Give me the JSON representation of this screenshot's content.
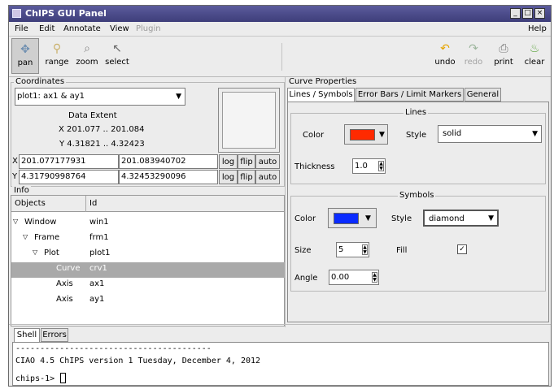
{
  "window": {
    "title": "ChIPS GUI Panel",
    "min": "_",
    "max": "□",
    "close": "×"
  },
  "menu": {
    "file": "File",
    "edit": "Edit",
    "annotate": "Annotate",
    "view": "View",
    "plugin": "Plugin",
    "help": "Help"
  },
  "toolbar": {
    "pan": "pan",
    "range": "range",
    "zoom": "zoom",
    "select": "select",
    "undo": "undo",
    "redo": "redo",
    "print": "print",
    "clear": "clear"
  },
  "coordinates": {
    "title": "Coordinates",
    "plot_select": "plot1: ax1 & ay1",
    "extent_title": "Data Extent",
    "x_extent": "X 201.077 .. 201.084",
    "y_extent": "Y 4.31821 .. 4.32423",
    "x_label": "X",
    "x_min": "201.077177931",
    "x_max": "201.083940702",
    "y_label": "Y",
    "y_min": "4.31790998764",
    "y_max": "4.32453290096",
    "log": "log",
    "flip": "flip",
    "auto": "auto"
  },
  "info": {
    "title": "Info",
    "col_objects": "Objects",
    "col_id": "Id",
    "rows": [
      {
        "object": "Window",
        "id": "win1"
      },
      {
        "object": "Frame",
        "id": "frm1"
      },
      {
        "object": "Plot",
        "id": "plot1"
      },
      {
        "object": "Curve",
        "id": "crv1"
      },
      {
        "object": "Axis",
        "id": "ax1"
      },
      {
        "object": "Axis",
        "id": "ay1"
      }
    ]
  },
  "curve": {
    "title": "Curve Properties",
    "tabs": [
      "Lines / Symbols",
      "Error Bars / Limit Markers",
      "General"
    ],
    "lines": {
      "title": "Lines",
      "color_label": "Color",
      "color": "#ff2a00",
      "style_label": "Style",
      "style": "solid",
      "thickness_label": "Thickness",
      "thickness": "1.0"
    },
    "symbols": {
      "title": "Symbols",
      "color_label": "Color",
      "color": "#0a2bff",
      "style_label": "Style",
      "style": "diamond",
      "size_label": "Size",
      "size": "5",
      "fill_label": "Fill",
      "fill_mark": "✓",
      "angle_label": "Angle",
      "angle": "0.00"
    }
  },
  "shell": {
    "tabs": [
      "Shell",
      "Errors"
    ],
    "rule": "----------------------------------------",
    "banner": "CIAO 4.5 ChIPS version 1 Tuesday, December 4, 2012",
    "prompt": "chips-1>"
  }
}
